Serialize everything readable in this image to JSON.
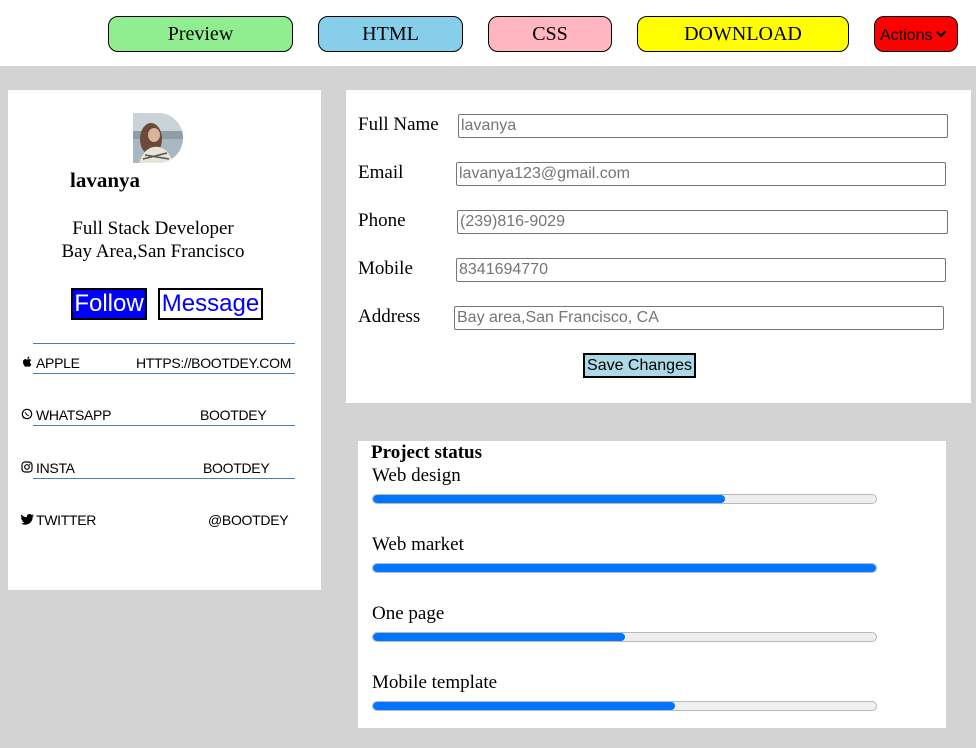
{
  "toolbar": {
    "preview": "Preview",
    "html": "HTML",
    "css": "CSS",
    "download": "DOWNLOAD",
    "actions": "Actions",
    "colors": {
      "preview": "#90ee90",
      "html": "#87ceeb",
      "css": "#ffb6c1",
      "download": "#ffff00",
      "actions": "#ff0000"
    }
  },
  "profile": {
    "name": "lavanya",
    "role": "Full Stack Developer",
    "location": "Bay Area,San Francisco",
    "follow": "Follow",
    "message": "Message"
  },
  "social": [
    {
      "icon": "apple-icon",
      "label": "APPLE",
      "value": "HTTPS://BOOTDEY.COM"
    },
    {
      "icon": "whatsapp-icon",
      "label": "WHATSAPP",
      "value": "BOOTDEY"
    },
    {
      "icon": "instagram-icon",
      "label": "INSTA",
      "value": "BOOTDEY"
    },
    {
      "icon": "twitter-icon",
      "label": "TWITTER",
      "value": "@BOOTDEY"
    }
  ],
  "form": {
    "fields": [
      {
        "label": "Full Name",
        "placeholder": "lavanya"
      },
      {
        "label": "Email",
        "placeholder": "lavanya123@gmail.com"
      },
      {
        "label": "Phone",
        "placeholder": "(239)816-9029"
      },
      {
        "label": "Mobile",
        "placeholder": "8341694770"
      },
      {
        "label": "Address",
        "placeholder": "Bay area,San Francisco, CA"
      }
    ],
    "save": "Save Changes"
  },
  "status": {
    "title": "Project status",
    "items": [
      {
        "label": "Web design",
        "progress": 0.7
      },
      {
        "label": "Web market",
        "progress": 1.0
      },
      {
        "label": "One page",
        "progress": 0.5
      },
      {
        "label": "Mobile template",
        "progress": 0.6
      }
    ]
  }
}
